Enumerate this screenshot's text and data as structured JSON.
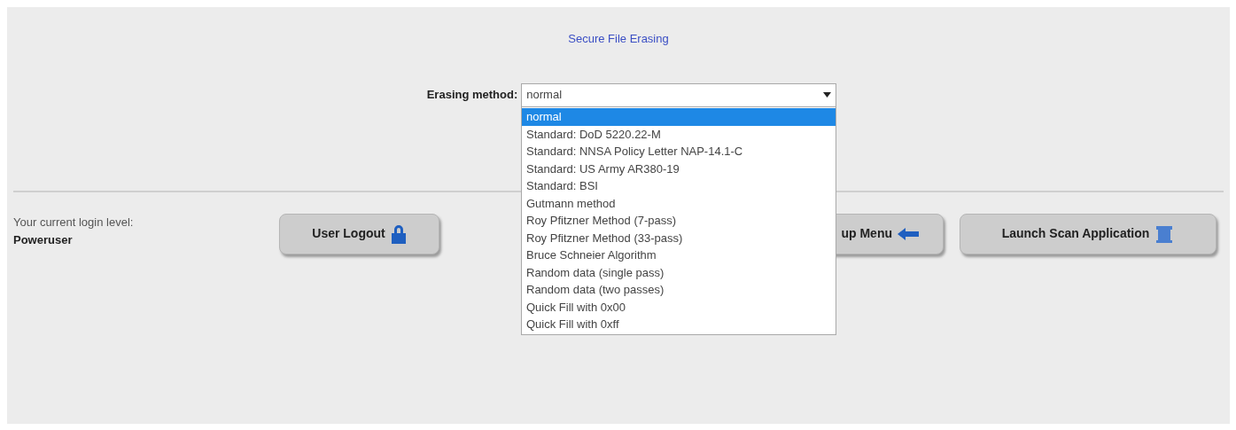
{
  "title": "Secure File Erasing",
  "erasing_method": {
    "label": "Erasing method:",
    "value": "normal",
    "expanded": true,
    "options": [
      {
        "label": "normal",
        "selected": true
      },
      {
        "label": "Standard: DoD 5220.22-M",
        "selected": false
      },
      {
        "label": "Standard: NNSA Policy Letter NAP-14.1-C",
        "selected": false
      },
      {
        "label": "Standard: US Army AR380-19",
        "selected": false
      },
      {
        "label": "Standard: BSI",
        "selected": false
      },
      {
        "label": "Gutmann method",
        "selected": false
      },
      {
        "label": "Roy Pfitzner Method (7-pass)",
        "selected": false
      },
      {
        "label": "Roy Pfitzner Method (33-pass)",
        "selected": false
      },
      {
        "label": "Bruce Schneier Algorithm",
        "selected": false
      },
      {
        "label": "Random data (single pass)",
        "selected": false
      },
      {
        "label": "Random data (two passes)",
        "selected": false
      },
      {
        "label": "Quick Fill with 0x00",
        "selected": false
      },
      {
        "label": "Quick Fill with 0xff",
        "selected": false
      }
    ]
  },
  "login": {
    "label": "Your current login level:",
    "level": "Poweruser"
  },
  "buttons": [
    {
      "kind": "logout",
      "label": "User Logout"
    },
    {
      "kind": "menu",
      "label": "up Menu"
    },
    {
      "kind": "scan",
      "label": "Launch Scan Application"
    }
  ]
}
